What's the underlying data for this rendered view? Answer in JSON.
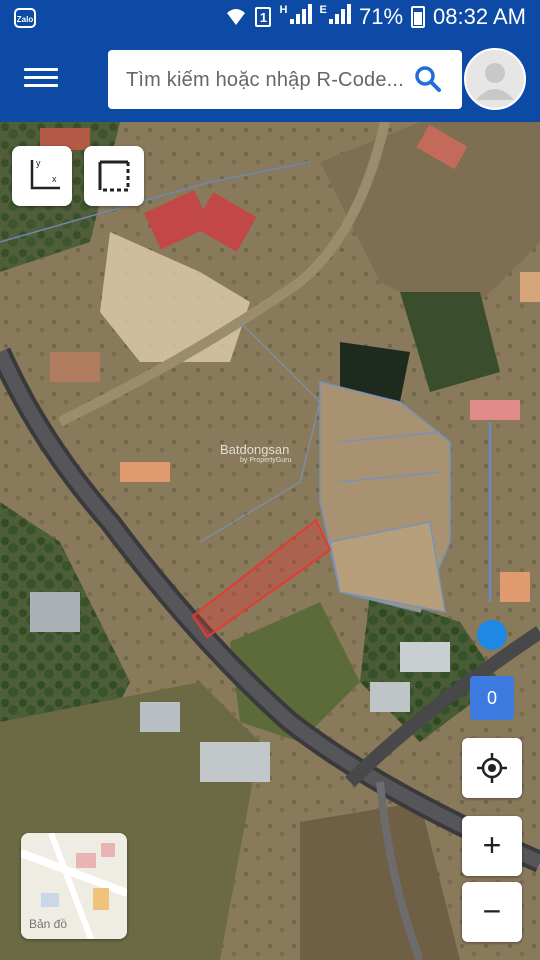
{
  "status_bar": {
    "app_icon": "Zalo",
    "sim_label": "1",
    "network_h": "H",
    "network_e": "E",
    "battery": "71%",
    "time": "08:32 AM",
    "icons": [
      "zalo-icon",
      "wifi-icon",
      "sim-icon",
      "signal-icon",
      "battery-icon"
    ]
  },
  "app_bar": {
    "menu_icon": "hamburger-menu-icon",
    "search_placeholder": "Tìm kiếm hoặc nhập R-Code...",
    "search_icon": "search-icon",
    "avatar_icon": "user-avatar-icon",
    "bg_color": "#0d4aa6"
  },
  "map": {
    "type": "satellite",
    "watermark": "Batdongsan",
    "watermark_sub": "by PropertyGuru",
    "tools": [
      "coordinate-axis-icon",
      "select-area-icon"
    ],
    "axis_y": "y",
    "axis_x": "x",
    "highlight_color": "#e53935",
    "result_count": "0",
    "controls": {
      "locate_icon": "crosshair-locate-icon",
      "zoom_in": "+",
      "zoom_out": "−"
    },
    "thumbnail_label": "Bản đồ"
  }
}
